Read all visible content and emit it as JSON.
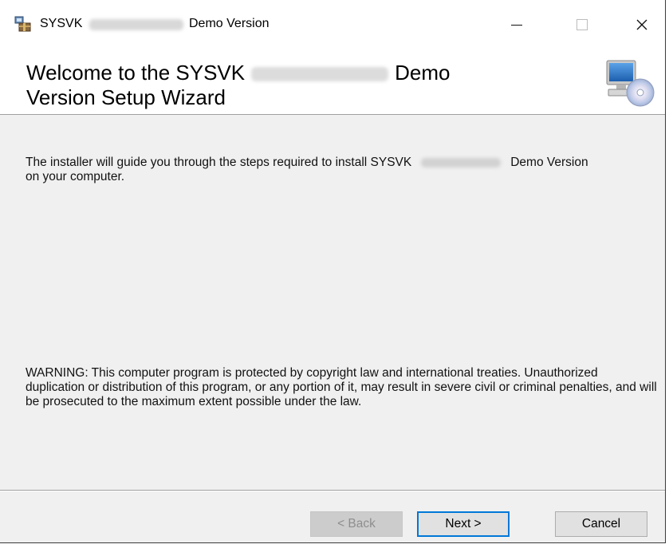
{
  "window": {
    "title_prefix": "SYSVK",
    "title_suffix": "Demo Version",
    "controls": {
      "minimize": "—",
      "maximize": "☐",
      "close": "✕"
    }
  },
  "header": {
    "line1_prefix": "Welcome to the SYSVK",
    "line1_suffix": "Demo",
    "line2": "Version Setup Wizard",
    "icon": "computer-cd-icon"
  },
  "content": {
    "intro_prefix": "The installer will guide you through the steps required to install SYSVK",
    "intro_suffix": "Demo Version",
    "intro_line2": "on your computer.",
    "warning": "WARNING: This computer program is protected by copyright law and international treaties. Unauthorized duplication or distribution of this program, or any portion of it, may result in severe civil or criminal penalties, and will be prosecuted to the maximum extent possible under the law."
  },
  "buttons": {
    "back": "< Back",
    "next": "Next >",
    "cancel": "Cancel"
  },
  "colors": {
    "focus_border": "#0078d7",
    "dialog_bg": "#f0f0f0"
  }
}
